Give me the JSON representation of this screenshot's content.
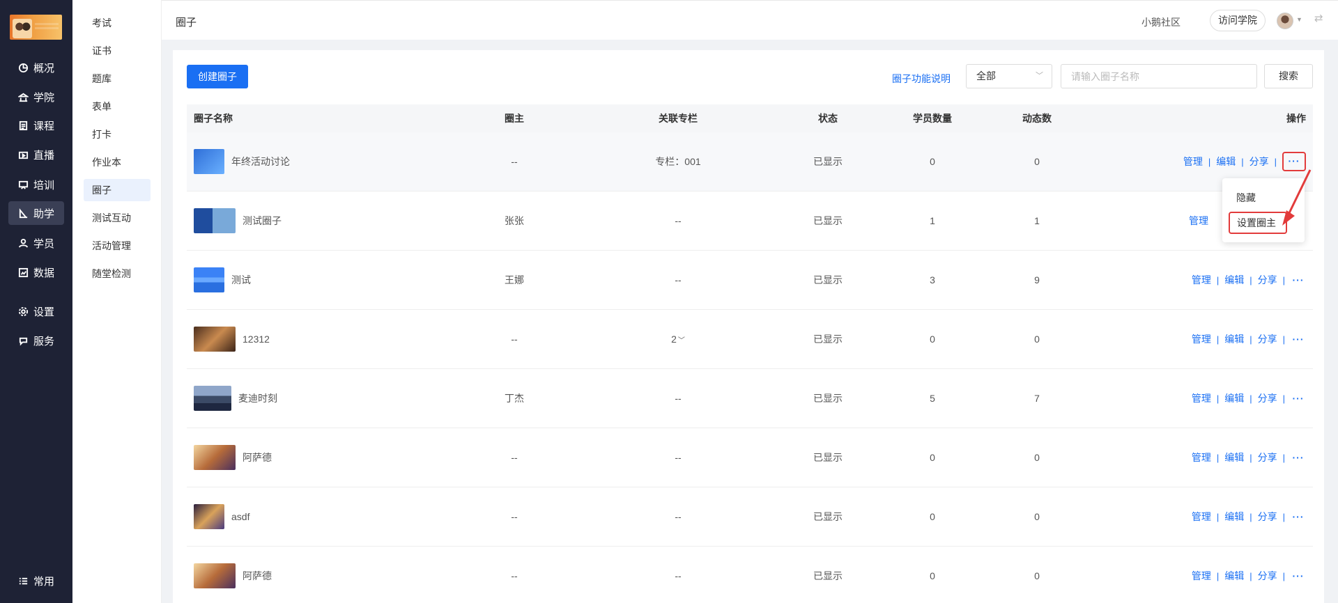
{
  "nav": {
    "items": [
      {
        "label": "概况",
        "icon": "pie-chart-icon"
      },
      {
        "label": "学院",
        "icon": "academy-icon"
      },
      {
        "label": "课程",
        "icon": "document-icon"
      },
      {
        "label": "直播",
        "icon": "live-icon"
      },
      {
        "label": "培训",
        "icon": "training-icon"
      },
      {
        "label": "助学",
        "icon": "study-aid-icon"
      },
      {
        "label": "学员",
        "icon": "user-icon"
      },
      {
        "label": "数据",
        "icon": "data-icon"
      },
      {
        "label": "设置",
        "icon": "gear-icon"
      },
      {
        "label": "服务",
        "icon": "service-icon"
      }
    ],
    "bottom_label": "常用",
    "active": "助学"
  },
  "submenu": {
    "items": [
      "考试",
      "证书",
      "题库",
      "表单",
      "打卡",
      "作业本",
      "圈子",
      "测试互动",
      "活动管理",
      "随堂检测"
    ],
    "active": "圈子"
  },
  "header": {
    "title": "圈子",
    "community": "小鹅社区",
    "visit_button": "访问学院"
  },
  "toolbar": {
    "create_button": "创建圈子",
    "help_link": "圈子功能说明",
    "filter_value": "全部",
    "search_placeholder": "请输入圈子名称",
    "search_button": "搜索"
  },
  "table": {
    "headers": {
      "name": "圈子名称",
      "owner": "圈主",
      "column": "关联专栏",
      "status": "状态",
      "members": "学员数量",
      "posts": "动态数",
      "ops": "操作"
    },
    "ops_labels": {
      "manage": "管理",
      "edit": "编辑",
      "share": "分享",
      "sep": "|",
      "more": "···"
    },
    "rows": [
      {
        "name": "年终活动讨论",
        "owner": "--",
        "column": "专栏：001",
        "status": "已显示",
        "members": "0",
        "posts": "0"
      },
      {
        "name": "测试圈子",
        "owner": "张张",
        "column": "--",
        "status": "已显示",
        "members": "1",
        "posts": "1"
      },
      {
        "name": "测试",
        "owner": "王娜",
        "column": "--",
        "status": "已显示",
        "members": "3",
        "posts": "9"
      },
      {
        "name": "12312",
        "owner": "--",
        "column": "2",
        "status": "已显示",
        "members": "0",
        "posts": "0"
      },
      {
        "name": "麦迪时刻",
        "owner": "丁杰",
        "column": "--",
        "status": "已显示",
        "members": "5",
        "posts": "7"
      },
      {
        "name": "阿萨德",
        "owner": "--",
        "column": "--",
        "status": "已显示",
        "members": "0",
        "posts": "0"
      },
      {
        "name": "asdf",
        "owner": "--",
        "column": "--",
        "status": "已显示",
        "members": "0",
        "posts": "0"
      },
      {
        "name": "阿萨德",
        "owner": "--",
        "column": "--",
        "status": "已显示",
        "members": "0",
        "posts": "0"
      }
    ]
  },
  "dropdown": {
    "items": [
      "隐藏",
      "设置圈主"
    ]
  },
  "colors": {
    "primary": "#1a6ff3",
    "nav_bg": "#1e2235",
    "highlight": "#e23b3b"
  }
}
